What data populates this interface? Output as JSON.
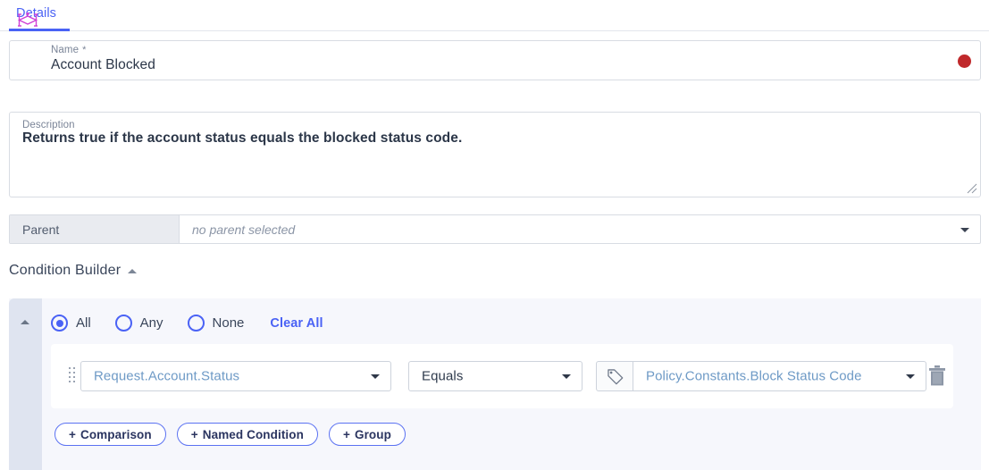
{
  "tabs": {
    "active_label": "Details"
  },
  "name_field": {
    "label": "Name",
    "required_mark": "*",
    "value": "Account Blocked",
    "icon": "condition-node-icon",
    "status_dot_color": "#c0292b"
  },
  "description_field": {
    "label": "Description",
    "value": "Returns true if the account status equals the blocked status code."
  },
  "parent_field": {
    "label": "Parent",
    "placeholder": "no parent selected",
    "value": ""
  },
  "condition_builder": {
    "title": "Condition Builder",
    "collapse_icon": "chevron-up-icon",
    "match_options": [
      {
        "label": "All",
        "selected": true
      },
      {
        "label": "Any",
        "selected": false
      },
      {
        "label": "None",
        "selected": false
      }
    ],
    "clear_all_label": "Clear All",
    "rows": [
      {
        "left_operand": "Request.Account.Status",
        "operator": "Equals",
        "right_operand": "Policy.Constants.Block Status Code",
        "right_operand_mode_icon": "tag-icon",
        "delete_icon": "trash-icon",
        "drag_icon": "drag-handle-icon"
      }
    ],
    "actions": [
      {
        "plus": "+",
        "label": "Comparison"
      },
      {
        "plus": "+",
        "label": "Named Condition"
      },
      {
        "plus": "+",
        "label": "Group"
      }
    ]
  },
  "theme": {
    "accent": "#4a62f5",
    "panel_bg": "#f6f7fc",
    "gutter_bg": "#dfe4f0",
    "text_dark": "#2b3648",
    "text_muted": "#7a8497",
    "operand_blue": "#6e9ac6"
  }
}
